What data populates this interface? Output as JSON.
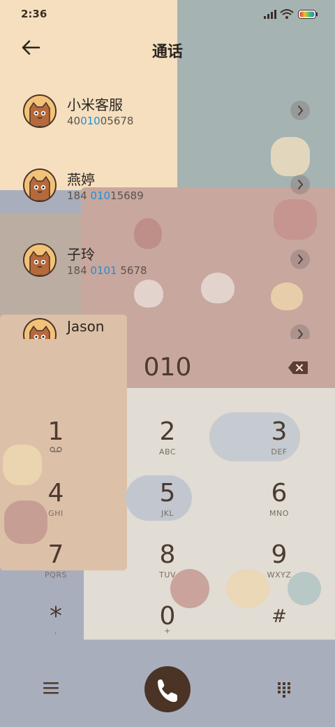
{
  "status_bar": {
    "time": "2:36"
  },
  "header": {
    "title": "通话"
  },
  "contacts": [
    {
      "name": "小米客服",
      "num_pre": "40",
      "num_hl": "010",
      "num_post": "05678"
    },
    {
      "name": "燕婷",
      "num_pre": "184 ",
      "num_hl": "010",
      "num_post": "15689"
    },
    {
      "name": "子玲",
      "num_pre": "184 ",
      "num_hl": "0101",
      "num_post": " 5678"
    },
    {
      "name": "Jason",
      "num_pre": "",
      "num_hl": "",
      "num_post": ""
    }
  ],
  "dialer": {
    "typed": "010",
    "keys": [
      {
        "digit": "1",
        "letters": ""
      },
      {
        "digit": "2",
        "letters": "ABC"
      },
      {
        "digit": "3",
        "letters": "DEF"
      },
      {
        "digit": "4",
        "letters": "GHI"
      },
      {
        "digit": "5",
        "letters": "JKL"
      },
      {
        "digit": "6",
        "letters": "MNO"
      },
      {
        "digit": "7",
        "letters": "PQRS"
      },
      {
        "digit": "8",
        "letters": "TUV"
      },
      {
        "digit": "9",
        "letters": "WXYZ"
      },
      {
        "digit": "*",
        "letters": ","
      },
      {
        "digit": "0",
        "letters": "+"
      },
      {
        "digit": "#",
        "letters": ""
      }
    ]
  },
  "colors": {
    "accent": "#1f8fd6",
    "call_button": "#4b3425"
  }
}
